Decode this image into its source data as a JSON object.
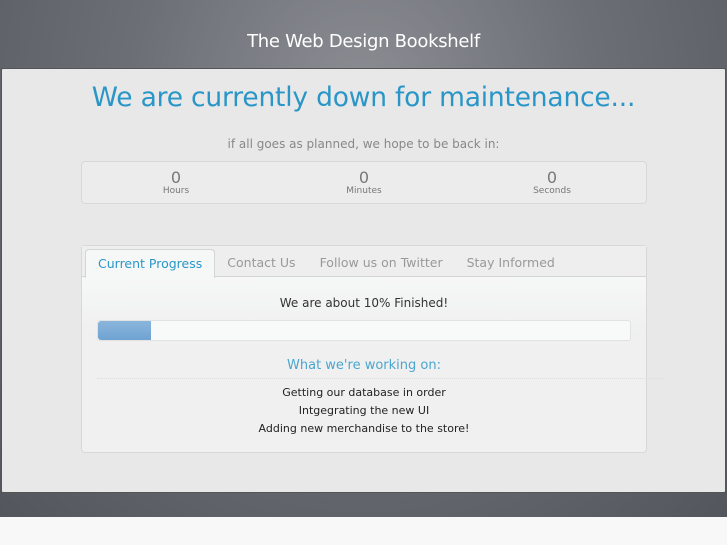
{
  "header": {
    "title": "The Web Design Bookshelf"
  },
  "main": {
    "headline": "We are currently down for maintenance...",
    "subtitle": "if all goes as planned, we hope to be back in:"
  },
  "countdown": [
    {
      "value": "0",
      "label": "Hours"
    },
    {
      "value": "0",
      "label": "Minutes"
    },
    {
      "value": "0",
      "label": "Seconds"
    }
  ],
  "tabs": [
    {
      "label": "Current Progress"
    },
    {
      "label": "Contact Us"
    },
    {
      "label": "Follow us on Twitter"
    },
    {
      "label": "Stay Informed"
    }
  ],
  "progress": {
    "text": "We are about 10% Finished!",
    "percent": 10
  },
  "working": {
    "title": "What we're working on:",
    "items": [
      "Getting our database in order",
      "Intgegrating the new UI",
      "Adding new merchandise to the store!"
    ]
  }
}
